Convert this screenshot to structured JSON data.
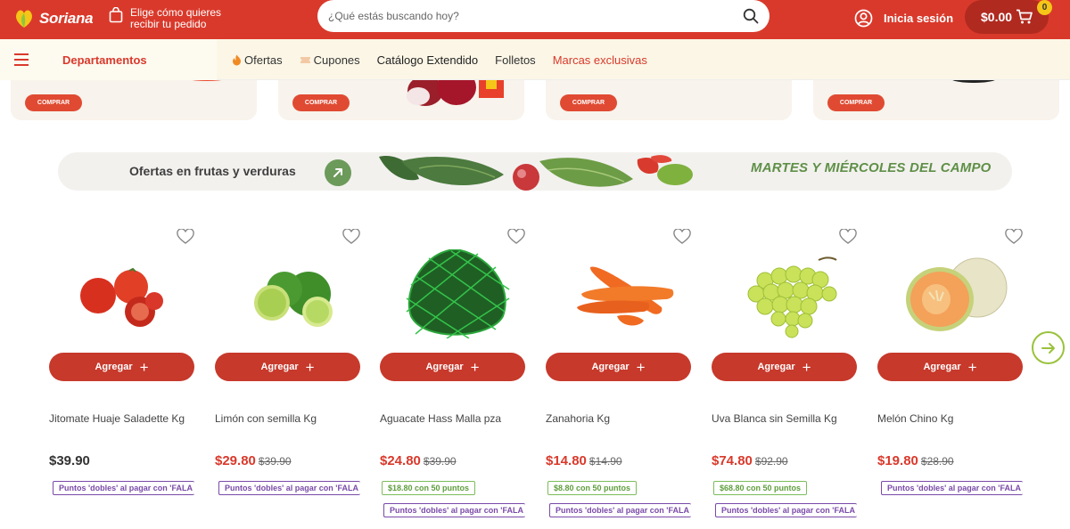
{
  "header": {
    "brand": "Soriana",
    "pedido_line1": "Elige cómo quieres",
    "pedido_line2": "recibir tu pedido",
    "search_placeholder": "¿Qué estás buscando hoy?",
    "login_label": "Inicia sesión",
    "cart_total": "$0.00",
    "cart_count": "0"
  },
  "nav": {
    "departments_label": "Departamentos",
    "links": [
      {
        "label": "Ofertas",
        "icon": "fire-icon"
      },
      {
        "label": "Cupones",
        "icon": "coupon-icon"
      },
      {
        "label": "Catálogo Extendido"
      },
      {
        "label": "Folletos"
      },
      {
        "label": "Marcas exclusivas"
      }
    ]
  },
  "promo_cards": [
    {
      "button": "COMPRAR"
    },
    {
      "button": "COMPRAR"
    },
    {
      "button": "COMPRAR"
    },
    {
      "button": "COMPRAR"
    }
  ],
  "banner": {
    "title": "Ofertas en frutas y verduras",
    "campaign": "MARTES Y MIÉRCOLES DEL CAMPO"
  },
  "products": [
    {
      "name": "Jitomate Huaje Saladette Kg",
      "price": "$39.90",
      "old_price": "",
      "points_offer": "",
      "promo": "Puntos 'dobles' al pagar con 'FALA",
      "add_label": "Agregar"
    },
    {
      "name": "Limón con semilla Kg",
      "price": "$29.80",
      "old_price": "$39.90",
      "points_offer": "",
      "promo": "Puntos 'dobles' al pagar con 'FALA",
      "add_label": "Agregar"
    },
    {
      "name": "Aguacate Hass Malla pza",
      "price": "$24.80",
      "old_price": "$39.90",
      "points_offer": "$18.80 con 50 puntos",
      "promo": "Puntos 'dobles' al pagar con 'FALA",
      "add_label": "Agregar"
    },
    {
      "name": "Zanahoria Kg",
      "price": "$14.80",
      "old_price": "$14.90",
      "points_offer": "$8.80 con 50 puntos",
      "promo": "Puntos 'dobles' al pagar con 'FALA",
      "add_label": "Agregar"
    },
    {
      "name": "Uva Blanca sin Semilla Kg",
      "price": "$74.80",
      "old_price": "$92.90",
      "points_offer": "$68.80 con 50 puntos",
      "promo": "Puntos 'dobles' al pagar con 'FALA",
      "add_label": "Agregar"
    },
    {
      "name": "Melón Chino Kg",
      "price": "$19.80",
      "old_price": "$28.90",
      "points_offer": "",
      "promo": "Puntos 'dobles' al pagar con 'FALA",
      "add_label": "Agregar"
    }
  ],
  "colors": {
    "brand_red": "#d9392b",
    "button_red": "#c7392b",
    "nav_bg": "#fbf6e6",
    "green_tag": "#5e9e3c",
    "purple_tag": "#7a4aa8",
    "campo_green": "#5f8f47"
  }
}
